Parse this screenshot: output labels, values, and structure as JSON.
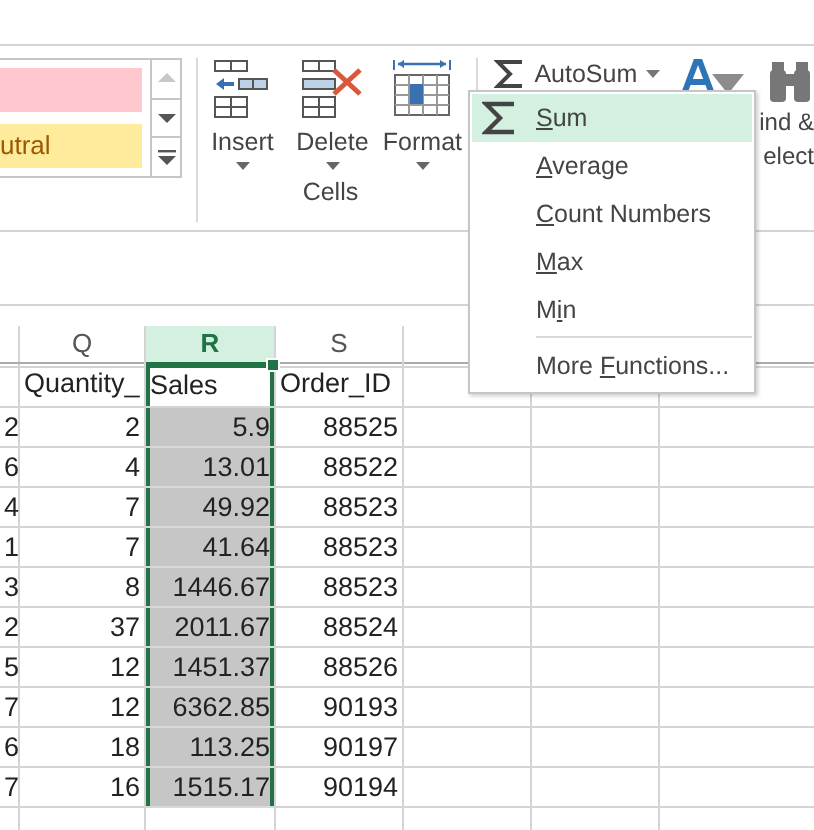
{
  "ribbon": {
    "styles": [
      {
        "color": "#ffc7ce"
      },
      {
        "label": "utral",
        "color": "#ffeb9c"
      }
    ],
    "cells_group": {
      "buttons": [
        {
          "label": "Insert"
        },
        {
          "label": "Delete"
        },
        {
          "label": "Format"
        }
      ],
      "label": "Cells"
    },
    "editing": {
      "autosum": "AutoSum",
      "find_select": [
        "ind &",
        "elect"
      ]
    }
  },
  "autosum_menu": {
    "items": [
      {
        "kind": "sum",
        "key": "S",
        "after": "um",
        "selected": true
      },
      {
        "kind": "function",
        "key": "A",
        "after": "verage",
        "selected": false
      },
      {
        "kind": "function",
        "key": "C",
        "after": "ount Numbers",
        "selected": false
      },
      {
        "kind": "function",
        "key": "M",
        "after": "ax",
        "selected": false
      },
      {
        "kind": "function",
        "before": "M",
        "key": "i",
        "after": "n",
        "selected": false
      },
      {
        "kind": "more",
        "before": "More ",
        "key": "F",
        "after": "unctions...",
        "selected": false
      }
    ]
  },
  "sheet": {
    "columns": [
      {
        "letter": "Q",
        "selected": false
      },
      {
        "letter": "R",
        "selected": true
      },
      {
        "letter": "S",
        "selected": false
      }
    ],
    "rows": [
      {
        "cells": [
          "Quantity_",
          "Sales",
          "Order_ID"
        ]
      },
      {
        "column_1": "2",
        "cells": [
          "2",
          "5.9",
          "88525"
        ]
      },
      {
        "column_1": "6",
        "cells": [
          "4",
          "13.01",
          "88522"
        ]
      },
      {
        "column_1": "4",
        "cells": [
          "7",
          "49.92",
          "88523"
        ]
      },
      {
        "column_1": "1",
        "cells": [
          "7",
          "41.64",
          "88523"
        ]
      },
      {
        "column_1": "3",
        "cells": [
          "8",
          "1446.67",
          "88523"
        ]
      },
      {
        "column_1": "2",
        "cells": [
          "37",
          "2011.67",
          "88524"
        ]
      },
      {
        "column_1": "5",
        "cells": [
          "12",
          "1451.37",
          "88526"
        ]
      },
      {
        "column_1": "7",
        "cells": [
          "12",
          "6362.85",
          "90193"
        ]
      },
      {
        "column_1": "6",
        "cells": [
          "18",
          "113.25",
          "90197"
        ]
      },
      {
        "column_1": "7",
        "cells": [
          "16",
          "1515.17",
          "90194"
        ]
      }
    ]
  }
}
